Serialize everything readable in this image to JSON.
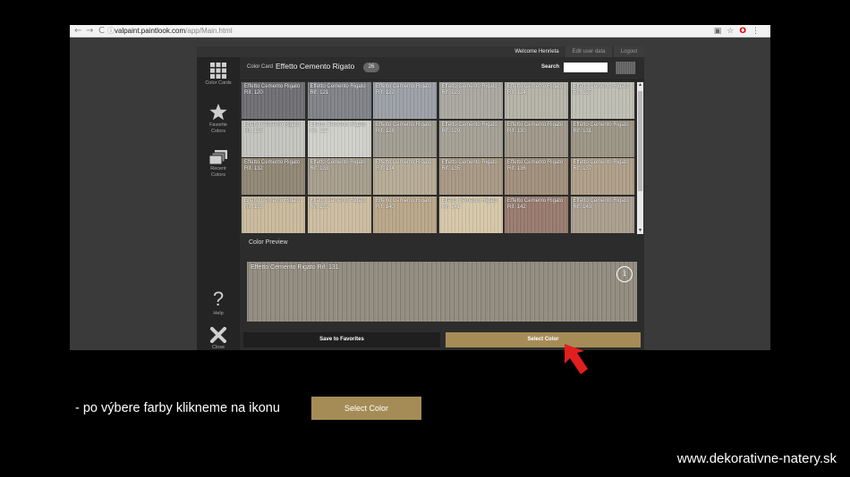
{
  "browser": {
    "back": "←",
    "forward": "→",
    "reload": "C",
    "info": "ⓘ",
    "url_host": "valpaint.paintlook.com",
    "url_path": "/app/Main.html",
    "icons": [
      "translate-icon",
      "star-icon",
      "opera-icon",
      "menu-icon"
    ]
  },
  "topbar": {
    "welcome": "Welcome Henrieta",
    "edit": "Edit user data",
    "logout": "Logout"
  },
  "sidebar": {
    "items": [
      {
        "label": "Color Cards",
        "icon": "grid-icon"
      },
      {
        "label": "Favorite Colors",
        "icon": "star-icon"
      },
      {
        "label": "Recent Colors",
        "icon": "layers-icon"
      },
      {
        "label": "Help",
        "icon": "question-icon"
      },
      {
        "label": "Close",
        "icon": "close-icon"
      }
    ]
  },
  "header": {
    "card_label": "Color Card",
    "card_name": "Effetto Cemento Rigato",
    "count": "26",
    "search_label": "Search",
    "search_value": ""
  },
  "swatches": [
    {
      "label": "Effetto Cemento Rigato Rif. 120",
      "color": "#6b6b70"
    },
    {
      "label": "Effetto Cemento Rigato Rif. 121",
      "color": "#7d7f85"
    },
    {
      "label": "Effetto Cemento Rigato Rif. 122",
      "color": "#9a9ea4"
    },
    {
      "label": "Effetto Cemento Rigato Rif. 123",
      "color": "#a8a69e"
    },
    {
      "label": "Effetto Cemento Rigato Rif. 124",
      "color": "#b4b2a6"
    },
    {
      "label": "Effetto Cemento Rigato Rif. 125",
      "color": "#bcbcb2"
    },
    {
      "label": "Effetto Cemento Rigato Rif. 126",
      "color": "#c2c3bd"
    },
    {
      "label": "Effetto Cemento Rigato Rif. 127",
      "color": "#cfcfca"
    },
    {
      "label": "Effetto Cemento Rigato Rif. 128",
      "color": "#a09b90"
    },
    {
      "label": "Effetto Cemento Rigato Rif. 129",
      "color": "#a39e92"
    },
    {
      "label": "Effetto Cemento Rigato Rif. 130",
      "color": "#9d9687"
    },
    {
      "label": "Effetto Cemento Rigato Rif. 131",
      "color": "#9a9383"
    },
    {
      "label": "Effetto Cemento Rigato Rif. 132",
      "color": "#8f8472"
    },
    {
      "label": "Effetto Cemento Rigato Rif. 133",
      "color": "#a49b8a"
    },
    {
      "label": "Effetto Cemento Rigato Rif. 134",
      "color": "#b4a992"
    },
    {
      "label": "Effetto Cemento Rigato Rif. 135",
      "color": "#a69681"
    },
    {
      "label": "Effetto Cemento Rigato Rif. 136",
      "color": "#9e8d78"
    },
    {
      "label": "Effetto Cemento Rigato Rif. 137",
      "color": "#ad9c86"
    },
    {
      "label": "Effetto Cemento Rigato Rif. 138",
      "color": "#c8b89a"
    },
    {
      "label": "Effetto Cemento Rigato Rif. 139",
      "color": "#cbbb9e"
    },
    {
      "label": "Effetto Cemento Rigato Rif. 140",
      "color": "#b8a486"
    },
    {
      "label": "Effetto Cemento Rigato Rif. 141",
      "color": "#d4c6a6"
    },
    {
      "label": "Effetto Cemento Rigato Rif. 142",
      "color": "#96786a"
    },
    {
      "label": "Effetto Cemento Rigato Rif. 143",
      "color": "#a89c8c"
    }
  ],
  "preview": {
    "title": "Color Preview",
    "label": "Effetto Cemento Rigato Rif. 131",
    "color": "#8e877a",
    "info": "i"
  },
  "buttons": {
    "favorites": "Save to Favorites",
    "select": "Select Color"
  },
  "slide": {
    "caption": "- po výbere farby klikneme na ikonu",
    "caption_button": "Select Color",
    "footer": "www.dekorativne-natery.sk"
  },
  "colors": {
    "accent": "#a58c57",
    "arrow": "#e31e1e",
    "background": "#000000"
  }
}
